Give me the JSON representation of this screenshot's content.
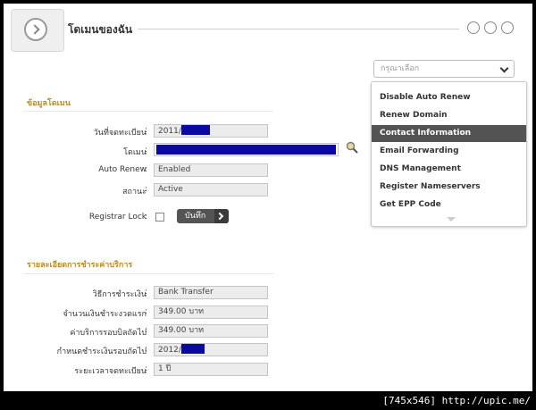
{
  "header": {
    "title": "โดเมนของฉัน"
  },
  "dropdown": {
    "placeholder": "กรุณาเลือก",
    "items": [
      "Disable Auto Renew",
      "Renew Domain",
      "Contact Information",
      "Email Forwarding",
      "DNS Management",
      "Register Nameservers",
      "Get EPP Code"
    ],
    "selected_index": 2
  },
  "domain_info": {
    "title": "ข้อมูลโดเมน",
    "reg_date_label": "วันที่จดทะเบียน",
    "reg_date_value": "2011/",
    "domain_label": "โดเมน",
    "auto_renew_label": "Auto Renew",
    "auto_renew_value": "Enabled",
    "status_label": "สถานะ",
    "status_value": "Active",
    "registrar_lock_label": "Registrar Lock",
    "save_label": "บันทึก"
  },
  "payment": {
    "title": "รายละเอียดการชำระค่าบริการ",
    "method_label": "วิธีการชำระเงิน",
    "method_value": "Bank Transfer",
    "first_payment_label": "จำนวนเงินชำระงวดแรก",
    "first_payment_value": "349.00 บาท",
    "recurring_label": "ค่าบริการรอบบิลถัดไป",
    "recurring_value": "349.00 บาท",
    "next_due_label": "กำหนดชำระเงินรอบถัดไป",
    "next_due_value": "2012/",
    "reg_period_label": "ระยะเวลาจดทะเบียน",
    "reg_period_value": "1 ปี"
  },
  "colon": ":",
  "watermark": "[745x546] http://upic.me/",
  "colors": {
    "redacted": "#0a0aa0",
    "section_title": "#c08a1e",
    "menu_selected": "#535353"
  }
}
